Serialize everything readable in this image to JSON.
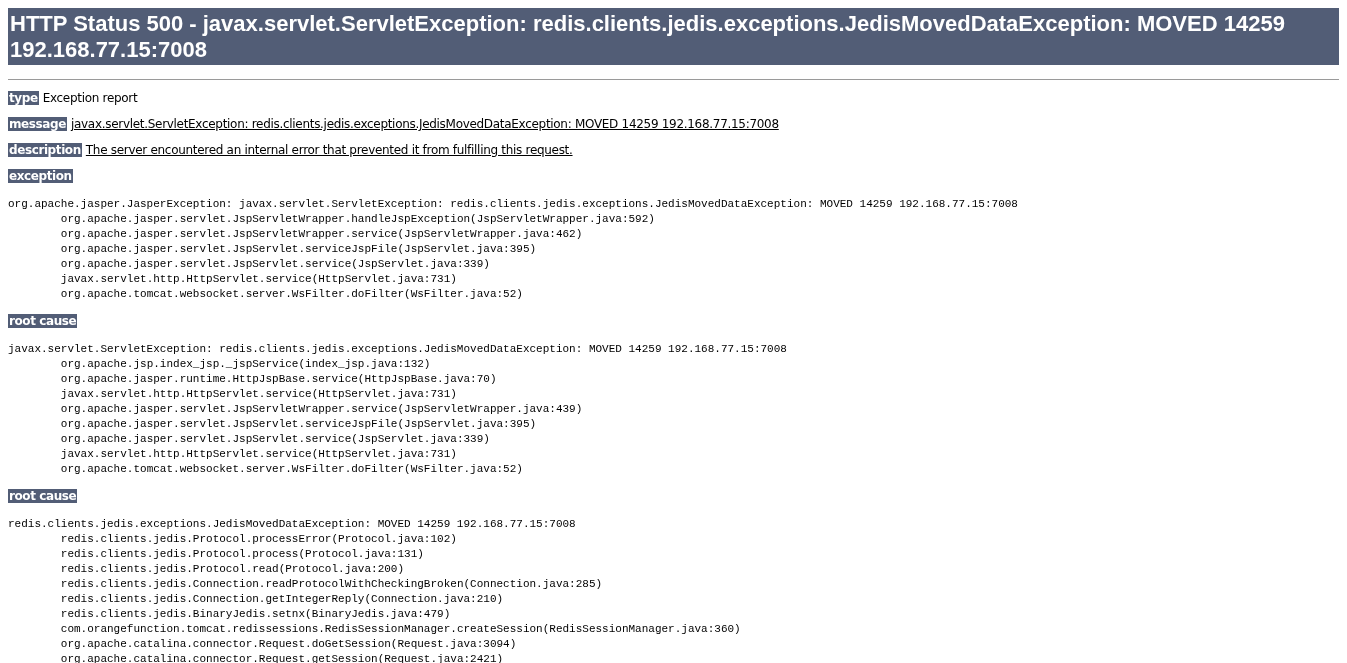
{
  "heading": "HTTP Status 500 - javax.servlet.ServletException: redis.clients.jedis.exceptions.JedisMovedDataException: MOVED 14259 192.168.77.15:7008",
  "fields": [
    {
      "label": "type",
      "value": "Exception report",
      "underlined": false
    },
    {
      "label": "message",
      "value": "javax.servlet.ServletException: redis.clients.jedis.exceptions.JedisMovedDataException: MOVED 14259 192.168.77.15:7008",
      "underlined": true
    },
    {
      "label": "description",
      "value": "The server encountered an internal error that prevented it from fulfilling this request.",
      "underlined": true
    }
  ],
  "sections": [
    {
      "label": "exception",
      "lines": [
        "org.apache.jasper.JasperException: javax.servlet.ServletException: redis.clients.jedis.exceptions.JedisMovedDataException: MOVED 14259 192.168.77.15:7008",
        "\torg.apache.jasper.servlet.JspServletWrapper.handleJspException(JspServletWrapper.java:592)",
        "\torg.apache.jasper.servlet.JspServletWrapper.service(JspServletWrapper.java:462)",
        "\torg.apache.jasper.servlet.JspServlet.serviceJspFile(JspServlet.java:395)",
        "\torg.apache.jasper.servlet.JspServlet.service(JspServlet.java:339)",
        "\tjavax.servlet.http.HttpServlet.service(HttpServlet.java:731)",
        "\torg.apache.tomcat.websocket.server.WsFilter.doFilter(WsFilter.java:52)"
      ]
    },
    {
      "label": "root cause",
      "lines": [
        "javax.servlet.ServletException: redis.clients.jedis.exceptions.JedisMovedDataException: MOVED 14259 192.168.77.15:7008",
        "\torg.apache.jsp.index_jsp._jspService(index_jsp.java:132)",
        "\torg.apache.jasper.runtime.HttpJspBase.service(HttpJspBase.java:70)",
        "\tjavax.servlet.http.HttpServlet.service(HttpServlet.java:731)",
        "\torg.apache.jasper.servlet.JspServletWrapper.service(JspServletWrapper.java:439)",
        "\torg.apache.jasper.servlet.JspServlet.serviceJspFile(JspServlet.java:395)",
        "\torg.apache.jasper.servlet.JspServlet.service(JspServlet.java:339)",
        "\tjavax.servlet.http.HttpServlet.service(HttpServlet.java:731)",
        "\torg.apache.tomcat.websocket.server.WsFilter.doFilter(WsFilter.java:52)"
      ]
    },
    {
      "label": "root cause",
      "lines": [
        "redis.clients.jedis.exceptions.JedisMovedDataException: MOVED 14259 192.168.77.15:7008",
        "\tredis.clients.jedis.Protocol.processError(Protocol.java:102)",
        "\tredis.clients.jedis.Protocol.process(Protocol.java:131)",
        "\tredis.clients.jedis.Protocol.read(Protocol.java:200)",
        "\tredis.clients.jedis.Connection.readProtocolWithCheckingBroken(Connection.java:285)",
        "\tredis.clients.jedis.Connection.getIntegerReply(Connection.java:210)",
        "\tredis.clients.jedis.BinaryJedis.setnx(BinaryJedis.java:479)",
        "\tcom.orangefunction.tomcat.redissessions.RedisSessionManager.createSession(RedisSessionManager.java:360)",
        "\torg.apache.catalina.connector.Request.doGetSession(Request.java:3094)",
        "\torg.apache.catalina.connector.Request.getSession(Request.java:2421)"
      ]
    }
  ]
}
